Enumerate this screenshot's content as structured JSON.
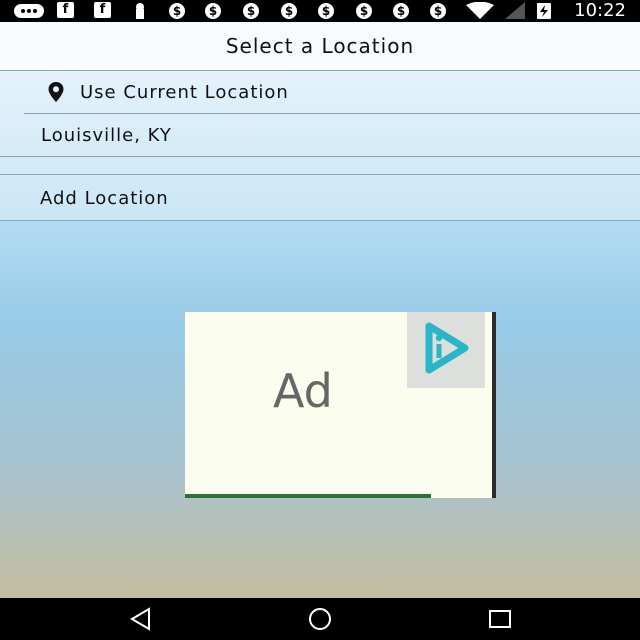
{
  "status_bar": {
    "time": "10:22",
    "icons": [
      "message-icon",
      "facebook-icon",
      "facebook-icon",
      "keyhole-icon",
      "dollar-icon",
      "dollar-icon",
      "dollar-icon",
      "dollar-icon",
      "dollar-icon",
      "dollar-icon",
      "dollar-icon",
      "dollar-icon",
      "wifi-icon",
      "no-signal-icon",
      "battery-charging-icon"
    ]
  },
  "header": {
    "title": "Select a Location"
  },
  "locations": {
    "current_label": "Use Current Location",
    "items": [
      "Louisville, KY"
    ],
    "add_label": "Add Location"
  },
  "ad": {
    "label": "Ad"
  },
  "nav": {
    "icons": [
      "back-icon",
      "home-icon",
      "recents-icon"
    ]
  },
  "colors": {
    "header_bg": "#f7fbfe",
    "divider": "#8aa6b8",
    "ad_bg": "#fbfdee",
    "adchoices_accent": "#29b6c8"
  }
}
